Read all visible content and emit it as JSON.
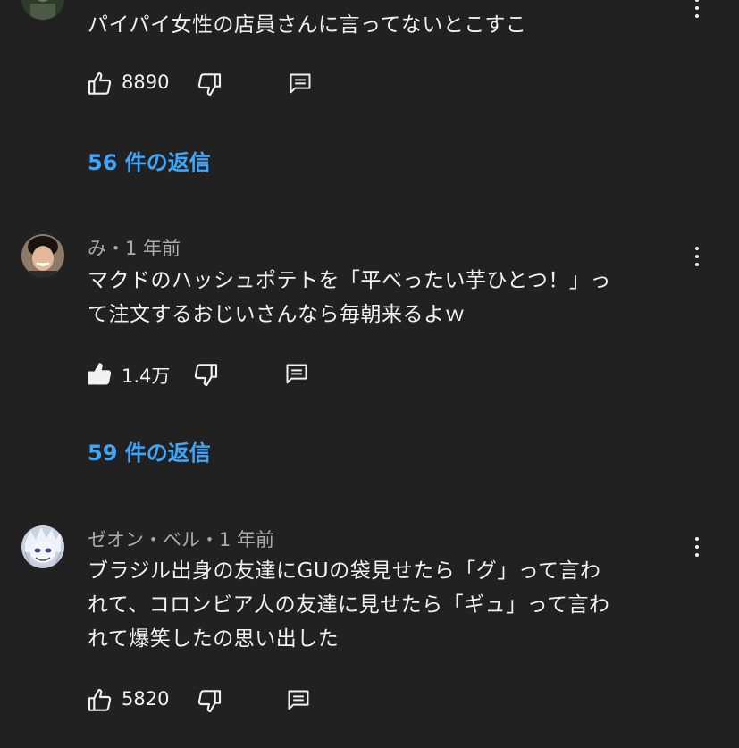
{
  "comments": [
    {
      "author": "",
      "meta": "",
      "lines": [
        "パイパイ女性の店員さんに言ってないとこすこ"
      ],
      "likes": "8890",
      "liked": false,
      "replies_label": "56 件の返信"
    },
    {
      "author": "み",
      "meta": "み・1 年前",
      "lines": [
        "マクドのハッシュポテトを「平べったい芋ひとつ！」っ",
        "て注文するおじいさんなら毎朝来るよｗ"
      ],
      "likes": "1.4万",
      "liked": true,
      "replies_label": "59 件の返信"
    },
    {
      "author": "ゼオン・ベル",
      "meta": "ゼオン・ベル・1 年前",
      "lines": [
        "ブラジル出身の友達にGUの袋見せたら「グ」って言わ",
        "れて、コロンビア人の友達に見せたら「ギュ」って言わ",
        "れて爆笑したの思い出した"
      ],
      "likes": "5820",
      "liked": false,
      "replies_label": ""
    }
  ],
  "colors": {
    "background": "#212121",
    "text": "#f1f1f1",
    "meta": "#aaaaaa",
    "link": "#3ea6ff"
  },
  "icons": {
    "like": "thumbs-up-icon",
    "dislike": "thumbs-down-icon",
    "reply": "comment-reply-icon",
    "more": "more-vertical-icon"
  }
}
